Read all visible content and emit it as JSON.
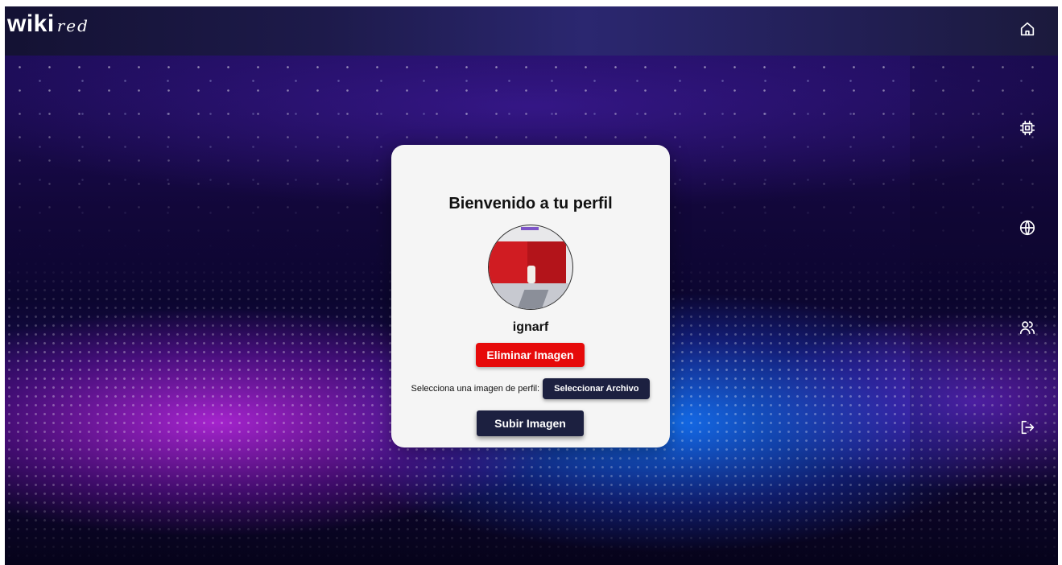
{
  "header": {
    "logo_main": "wiki",
    "logo_sub": "red"
  },
  "nav": {
    "items": [
      {
        "name": "home",
        "icon": "home-icon"
      },
      {
        "name": "components",
        "icon": "cpu-icon"
      },
      {
        "name": "network",
        "icon": "globe-icon"
      },
      {
        "name": "users",
        "icon": "users-icon"
      },
      {
        "name": "logout",
        "icon": "logout-icon"
      }
    ]
  },
  "profile": {
    "title": "Bienvenido a tu perfil",
    "username": "ignarf",
    "delete_label": "Eliminar Imagen",
    "file_prompt": "Selecciona una imagen de perfil:",
    "file_button_label": "Seleccionar Archivo",
    "upload_label": "Subir Imagen"
  },
  "colors": {
    "delete": "#e60a0a",
    "primary_dark": "#1c2040",
    "card_bg": "#f5f5f5"
  }
}
